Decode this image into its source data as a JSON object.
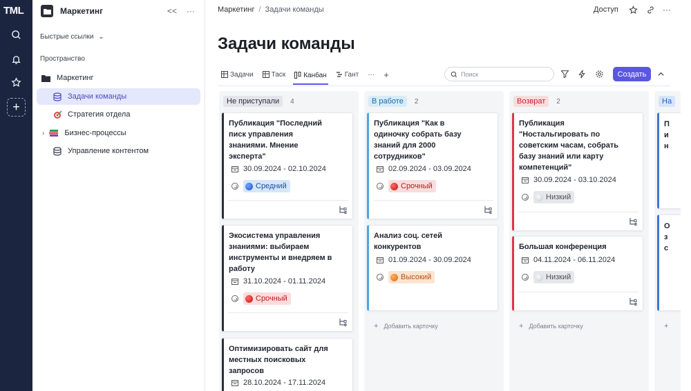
{
  "app": {
    "logo": "TML"
  },
  "sidebar": {
    "title": "Маркетинг",
    "collapse": "<<",
    "more": "···",
    "quick_links": "Быстрые ссылки",
    "space_label": "Пространство",
    "items": [
      {
        "label": "Маркетинг",
        "icon": "folder-icon"
      },
      {
        "label": "Задачи команды",
        "icon": "database-icon",
        "active": true
      },
      {
        "label": "Стратегия отдела",
        "icon": "target-icon"
      },
      {
        "label": "Бизнес-процессы",
        "icon": "books-icon"
      },
      {
        "label": "Управление контентом",
        "icon": "database-icon"
      }
    ]
  },
  "breadcrumb": {
    "root": "Маркетинг",
    "sep": "/",
    "current": "Задачи команды"
  },
  "topbar": {
    "access": "Доступ"
  },
  "page": {
    "title": "Задачи команды"
  },
  "tabs": [
    {
      "label": "Задачи",
      "icon": "table-icon"
    },
    {
      "label": "Таск",
      "icon": "table-icon"
    },
    {
      "label": "Канбан",
      "icon": "kanban-icon",
      "active": true
    },
    {
      "label": "Гант",
      "icon": "gantt-icon"
    },
    {
      "label": "···"
    },
    {
      "label": "+"
    }
  ],
  "search": {
    "placeholder": "Поиск"
  },
  "actions": {
    "create": "Создать"
  },
  "add_card": "Добавить карточку",
  "colors": {
    "accent": "#5b57e0",
    "not_started": "#2b2f3a",
    "in_progress": "#4aa6e8",
    "returned": "#e0334f",
    "next": "#3a78d8"
  },
  "columns": [
    {
      "name": "Не приступали",
      "count": "4",
      "cards": [
        {
          "title": "Публикация \"Последний писк управления знаниями. Мнение эксперта\"",
          "dates": "30.09.2024 - 02.10.2024",
          "priority": "Средний"
        },
        {
          "title": "Экосистема управления знаниями: выбираем инструменты и внедряем в работу",
          "dates": "31.10.2024 - 01.11.2024",
          "priority": "Срочный"
        },
        {
          "title": "Оптимизировать сайт для местных поисковых запросов",
          "dates": "28.10.2024 - 17.11.2024"
        }
      ]
    },
    {
      "name": "В работе",
      "count": "2",
      "cards": [
        {
          "title": "Публикация \"Как в одиночку собрать базу знаний для 2000 сотрудников\"",
          "dates": "02.09.2024 - 03.09.2024",
          "priority": "Срочный"
        },
        {
          "title": "Анализ соц. сетей конкурентов",
          "dates": "01.09.2024 - 30.09.2024",
          "priority": "Высокий"
        }
      ]
    },
    {
      "name": "Возврат",
      "count": "2",
      "cards": [
        {
          "title": "Публикация \"Ностальгировать по советским часам, собрать базу знаний или карту компетенций\"",
          "dates": "30.09.2024 - 03.10.2024",
          "priority": "Низкий"
        },
        {
          "title": "Большая конференция",
          "dates": "04.11.2024 - 06.11.2024",
          "priority": "Низкий"
        }
      ]
    },
    {
      "name": "На",
      "card_lines": [
        "П",
        "и",
        "н",
        "О",
        "з",
        "с"
      ]
    }
  ]
}
